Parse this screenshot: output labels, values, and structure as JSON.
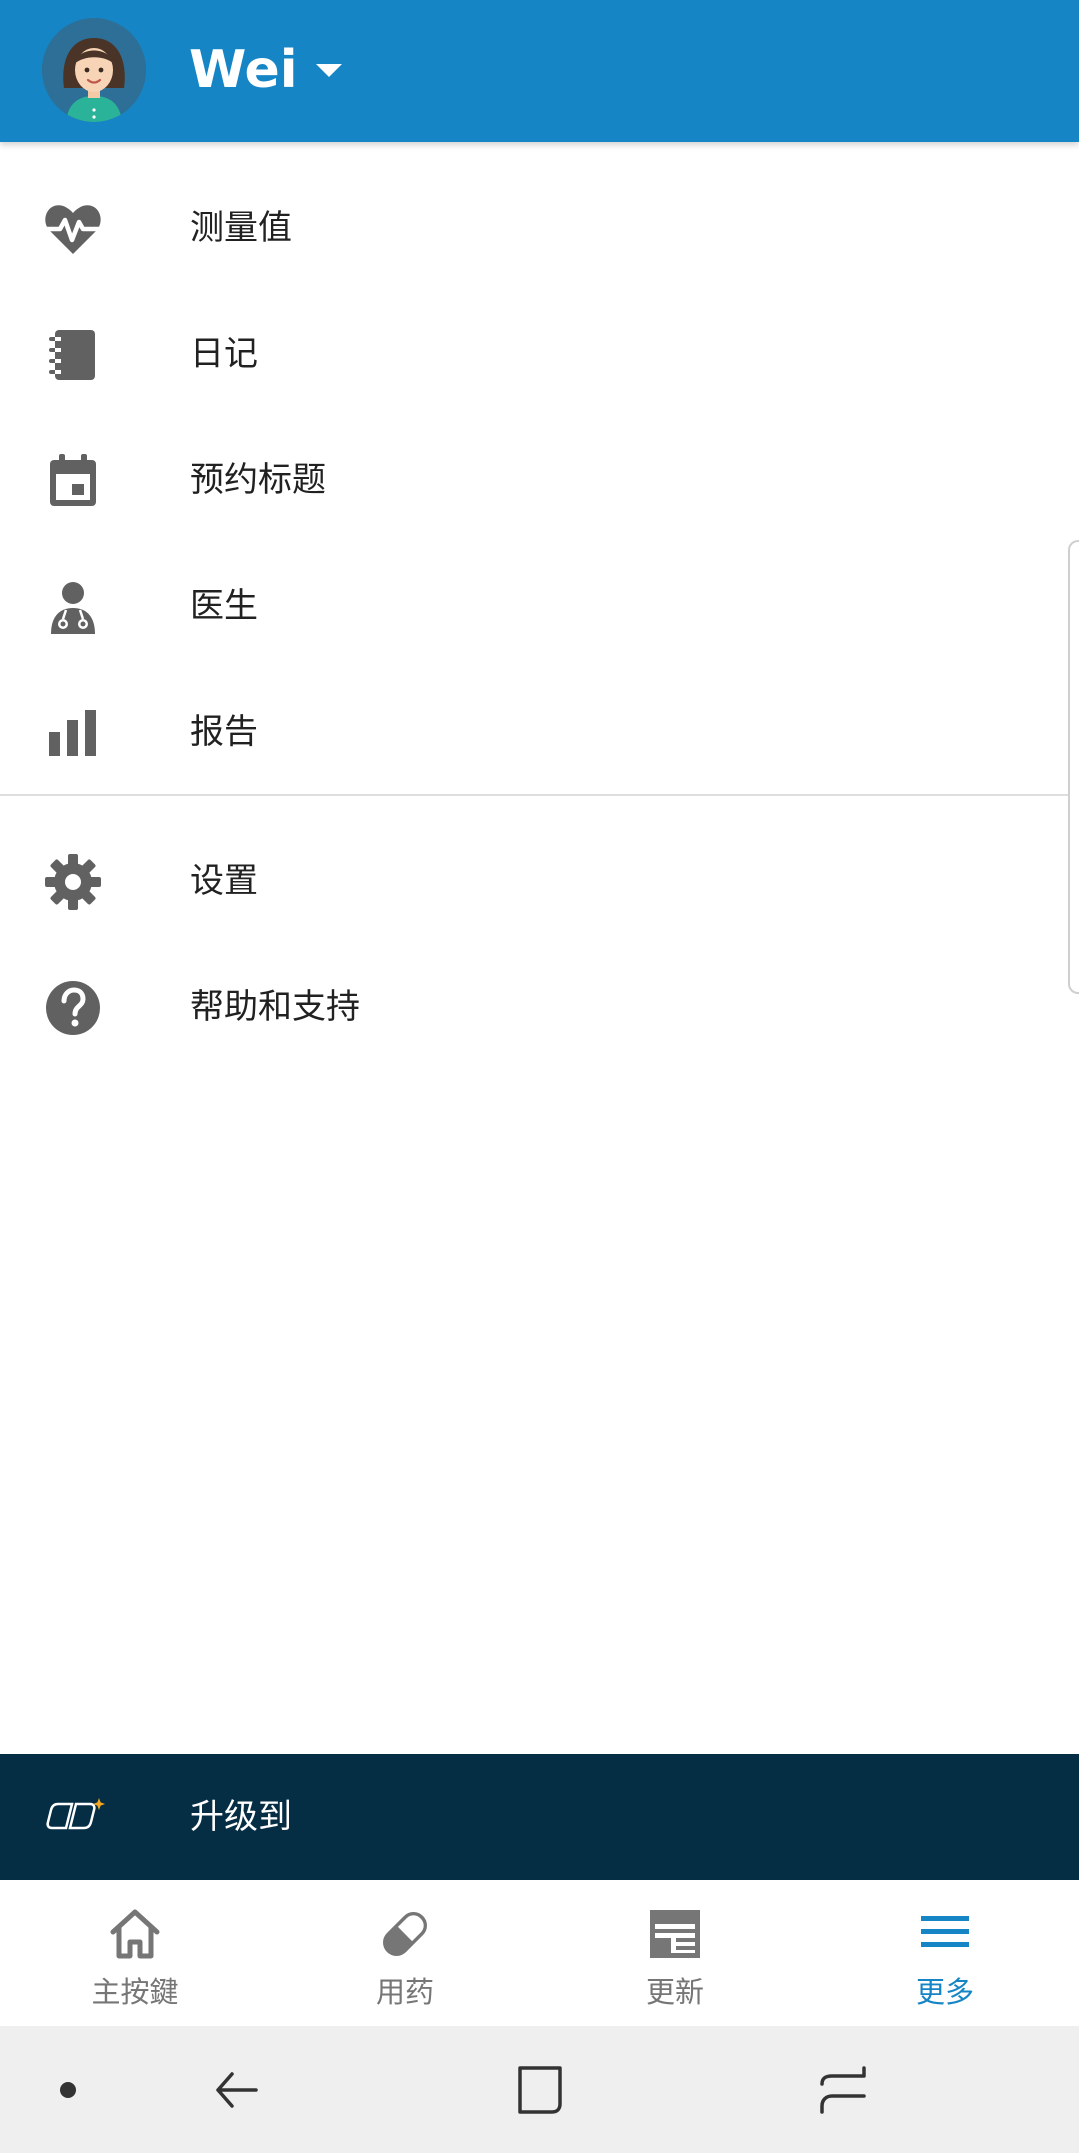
{
  "header": {
    "profile_name": "Wei",
    "avatar_icon": "avatar-woman",
    "dropdown_icon": "caret-down-icon",
    "background": "#1685c5"
  },
  "menu": {
    "items": [
      {
        "label": "测量值",
        "icon": "heartbeat-icon"
      },
      {
        "label": "日记",
        "icon": "notebook-icon"
      },
      {
        "label": "预约标题",
        "icon": "calendar-icon"
      },
      {
        "label": "医生",
        "icon": "doctor-icon"
      },
      {
        "label": "报告",
        "icon": "bar-chart-icon"
      },
      {
        "label": "设置",
        "icon": "gear-icon"
      },
      {
        "label": "帮助和支持",
        "icon": "help-icon"
      }
    ]
  },
  "upgrade": {
    "label": "升级到",
    "icon": "premium-logo-icon",
    "background": "#052d44"
  },
  "bottom_nav": {
    "tabs": [
      {
        "label": "主按鍵",
        "icon": "home-icon",
        "active": false
      },
      {
        "label": "用药",
        "icon": "pill-icon",
        "active": false
      },
      {
        "label": "更新",
        "icon": "news-icon",
        "active": false
      },
      {
        "label": "更多",
        "icon": "menu-icon",
        "active": true
      }
    ],
    "active_color": "#1685c5",
    "inactive_color": "#767676"
  },
  "system_nav": {
    "buttons": [
      "dot-icon",
      "back-icon",
      "recents-icon",
      "switch-icon"
    ]
  }
}
